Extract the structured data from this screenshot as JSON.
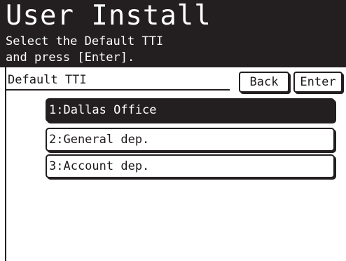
{
  "header": {
    "title": "User Install",
    "instruction_line1": "Select the Default TTI",
    "instruction_line2": "and press [Enter]."
  },
  "field": {
    "label": "Default TTI"
  },
  "buttons": {
    "back_label": "Back",
    "enter_label": "Enter"
  },
  "list": {
    "items": [
      {
        "label": "1:Dallas Office",
        "selected": true
      },
      {
        "label": "2:General dep.",
        "selected": false
      },
      {
        "label": "3:Account dep.",
        "selected": false
      }
    ]
  },
  "colors": {
    "header_background": "#231f20",
    "header_text": "#ffffff",
    "selected_background": "#231f20",
    "selected_text": "#ffffff",
    "foreground": "#1e1a1b"
  }
}
